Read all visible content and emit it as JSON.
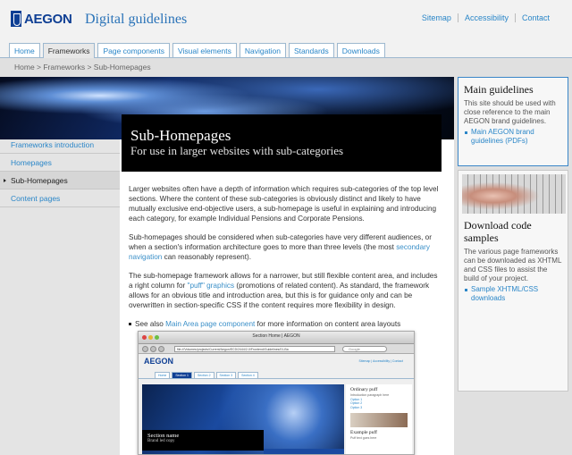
{
  "header": {
    "logo_text": "AEGON",
    "site_title": "Digital guidelines",
    "utility_links": [
      "Sitemap",
      "Accessibility",
      "Contact"
    ]
  },
  "nav": {
    "tabs": [
      "Home",
      "Frameworks",
      "Page components",
      "Visual elements",
      "Navigation",
      "Standards",
      "Downloads"
    ],
    "active": "Frameworks"
  },
  "breadcrumb": "Home > Frameworks > Sub-Homepages",
  "hero": {
    "title": "Sub-Homepages",
    "subtitle": "For use in larger websites with sub-categories"
  },
  "leftnav": {
    "items": [
      "Frameworks introduction",
      "Homepages",
      "Sub-Homepages",
      "Content pages"
    ],
    "active": "Sub-Homepages"
  },
  "content": {
    "p1": "Larger websites often have a depth of information which requires sub-categories of the top level sections. Where the content of these sub-categories is obviously distinct and likely to have mutually exclusive end-objective users, a sub-homepage is useful in explaining and introducing each category, for example Individual Pensions and Corporate Pensions.",
    "p2_a": "Sub-homepages should be considered when sub-categories have very different audiences, or when a section's information architecture goes to more than three levels (the most ",
    "p2_link": "secondary navigation",
    "p2_b": " can reasonably represent).",
    "p3_a": "The sub-homepage framework allows for a narrower, but still flexible content area, and includes a right column for ",
    "p3_link": "\"puff\" graphics",
    "p3_b": " (promotions of related content). As standard, the framework allows for an obvious title and introduction area, but this is for guidance only and can be overwritten in section-specific CSS if the content requires more flexibility in design.",
    "see_a": "See also ",
    "see_link": "Main Area page component",
    "see_b": " for more information on content area layouts"
  },
  "screenshot": {
    "window_title": "Section Home | AEGON",
    "url": "file:///Volumes/projects/Current/Aegon/ECD/2444/2-0/Frontend/Guidelines/01-Ba",
    "search_placeholder": "Google",
    "logo": "AEGON",
    "links": "Sitemap  |  Accessibility  |  Contact",
    "tabs": [
      "Home",
      "Section 1",
      "Section 2",
      "Section 3",
      "Section 4"
    ],
    "active_tab": "Section 1",
    "caption_title": "Section name",
    "caption_sub": "Brand led copy",
    "intro": "Introduction to the section goes here. Introduction to the section goes here. Introduction to the section goes here.",
    "side_heading": "Ordinary puff",
    "side_text": "Introduction paragraph here",
    "side_links": [
      "Option 1",
      "Option 2",
      "Option 3"
    ],
    "side_heading2": "Example puff",
    "side_text2": "Puff text goes here"
  },
  "right": {
    "box1": {
      "heading": "Main guidelines",
      "text": "This site should be used with close reference to the main AEGON brand guidelines.",
      "link": "Main AEGON brand guidelines (PDFs)"
    },
    "box2": {
      "heading": "Download code samples",
      "text": "The various page frameworks can be downloaded as XHTML and CSS files to assist the build of your project.",
      "link": "Sample XHTML/CSS downloads"
    }
  },
  "colors": {
    "brand_blue": "#0f3f94",
    "link_blue": "#2a86c8",
    "hero_caption_bg": "#000000"
  }
}
